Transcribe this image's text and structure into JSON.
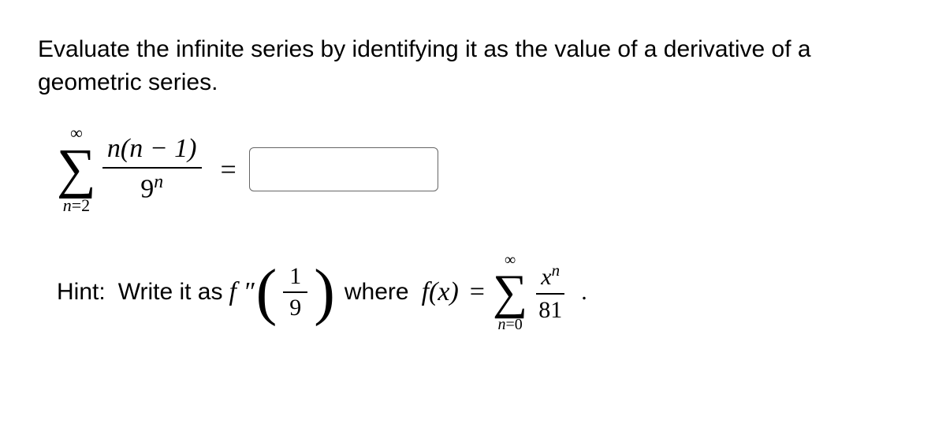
{
  "prompt": "Evaluate the infinite series by identifying it as the value of a derivative of a geometric series.",
  "series": {
    "upper": "∞",
    "lowerVar": "n",
    "lowerEq": "=",
    "lowerVal": "2",
    "numerator": "n(n − 1)",
    "denBase": "9",
    "denExp": "n",
    "equals": "="
  },
  "answer": "",
  "hint": {
    "label": "Hint:",
    "write": "Write it as",
    "fpp": "f ″",
    "fracNum": "1",
    "fracDen": "9",
    "where": "where",
    "fx": "f(x)",
    "eq": "=",
    "sumUpper": "∞",
    "sumLowerVar": "n",
    "sumLowerEq": "=",
    "sumLowerVal": "0",
    "termNumBase": "x",
    "termNumExp": "n",
    "termDen": "81",
    "period": "."
  }
}
